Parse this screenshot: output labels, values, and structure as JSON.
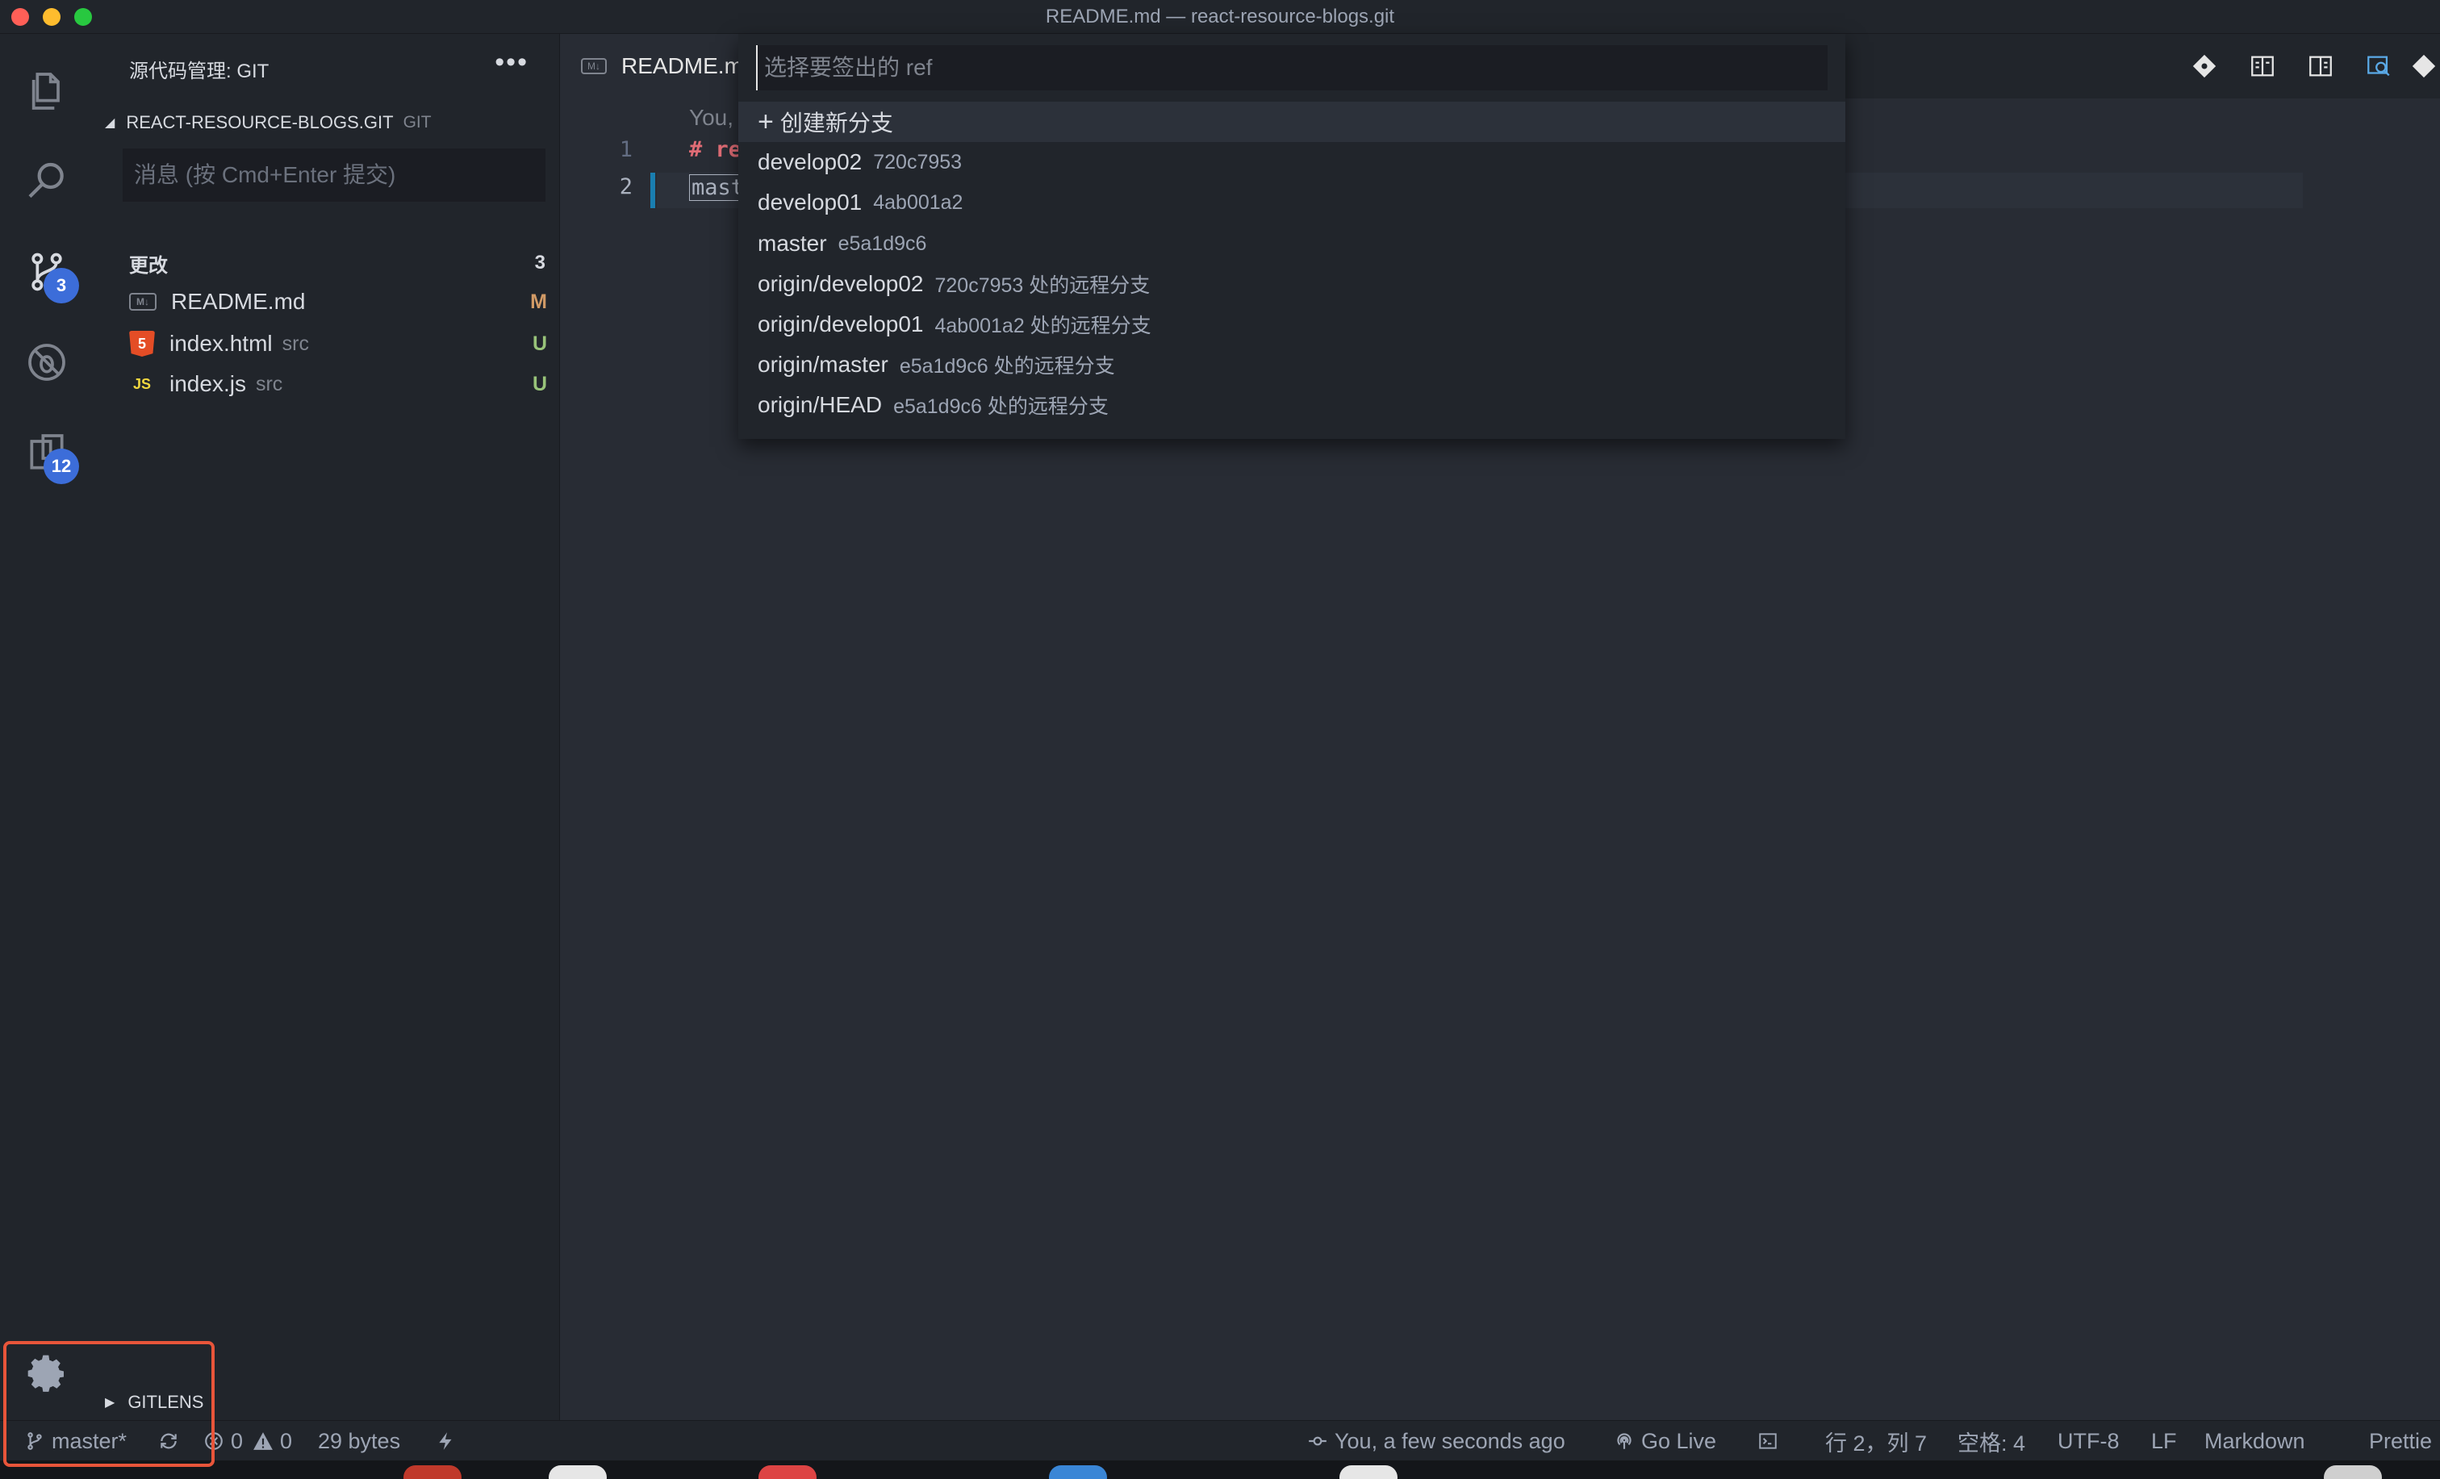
{
  "window": {
    "title": "README.md — react-resource-blogs.git"
  },
  "activity_bar": {
    "scm_badge": "3",
    "ext_badge": "12"
  },
  "sidebar": {
    "header": "源代码管理: GIT",
    "more": "•••",
    "repo": {
      "name": "REACT-RESOURCE-BLOGS.GIT",
      "tag": "GIT"
    },
    "commit_placeholder": "消息 (按 Cmd+Enter 提交)",
    "changes": {
      "label": "更改",
      "count": "3"
    },
    "files": [
      {
        "name": "README.md",
        "dir": "",
        "status": "M",
        "icon_label": "M↓"
      },
      {
        "name": "index.html",
        "dir": "src",
        "status": "U",
        "icon_label": "5"
      },
      {
        "name": "index.js",
        "dir": "src",
        "status": "U",
        "icon_label": "JS"
      }
    ],
    "gitlens": "GITLENS"
  },
  "editor": {
    "tab_label": "README.md",
    "tab_icon_label": "M↓",
    "blame": "You,",
    "lines": [
      {
        "num": "1",
        "text": "# re"
      },
      {
        "num": "2",
        "text": "mast"
      }
    ]
  },
  "quickpick": {
    "placeholder": "选择要签出的 ref",
    "create_label": "创建新分支",
    "items": [
      {
        "label": "develop02",
        "desc": "720c7953"
      },
      {
        "label": "develop01",
        "desc": "4ab001a2"
      },
      {
        "label": "master",
        "desc": "e5a1d9c6"
      },
      {
        "label": "origin/develop02",
        "desc": "720c7953 处的远程分支"
      },
      {
        "label": "origin/develop01",
        "desc": "4ab001a2 处的远程分支"
      },
      {
        "label": "origin/master",
        "desc": "e5a1d9c6 处的远程分支"
      },
      {
        "label": "origin/HEAD",
        "desc": "e5a1d9c6 处的远程分支"
      }
    ]
  },
  "statusbar": {
    "branch": "master*",
    "errors": "0",
    "warnings": "0",
    "size": "29 bytes",
    "blame": "You, a few seconds ago",
    "golive": "Go Live",
    "position": "行 2，列 7",
    "spaces": "空格: 4",
    "encoding": "UTF-8",
    "eol": "LF",
    "language": "Markdown",
    "prettier": "Prettie"
  },
  "colors": {
    "accent_badge": "#3c6dd9",
    "modified": "#d19a66",
    "untracked": "#98c379",
    "highlight_box": "#e8553a"
  }
}
